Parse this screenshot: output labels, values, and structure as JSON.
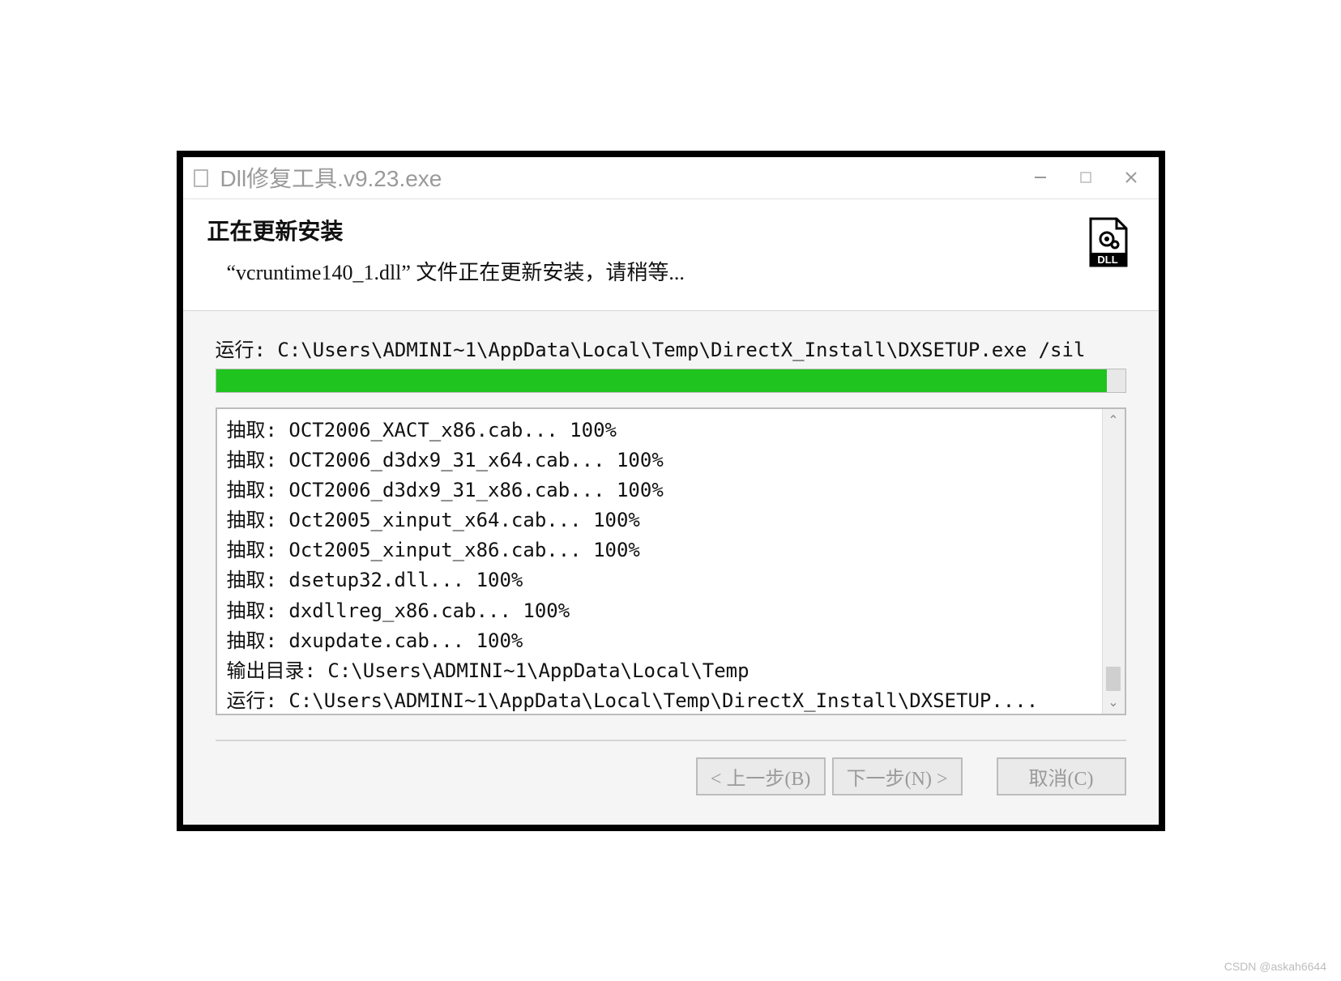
{
  "window": {
    "title": "Dll修复工具.v9.23.exe"
  },
  "header": {
    "title": "正在更新安装",
    "subtitle": "“vcruntime140_1.dll” 文件正在更新安装，请稍等..."
  },
  "progress": {
    "run_label": "运行: C:\\Users\\ADMINI~1\\AppData\\Local\\Temp\\DirectX_Install\\DXSETUP.exe /sil",
    "percent": 98
  },
  "log": {
    "lines": [
      "抽取: OCT2006_XACT_x86.cab... 100%",
      "抽取: OCT2006_d3dx9_31_x64.cab... 100%",
      "抽取: OCT2006_d3dx9_31_x86.cab... 100%",
      "抽取: Oct2005_xinput_x64.cab... 100%",
      "抽取: Oct2005_xinput_x86.cab... 100%",
      "抽取: dsetup32.dll... 100%",
      "抽取: dxdllreg_x86.cab... 100%",
      "抽取: dxupdate.cab... 100%",
      "输出目录: C:\\Users\\ADMINI~1\\AppData\\Local\\Temp",
      "运行: C:\\Users\\ADMINI~1\\AppData\\Local\\Temp\\DirectX_Install\\DXSETUP...."
    ]
  },
  "buttons": {
    "back": "< 上一步(B)",
    "next": "下一步(N) >",
    "cancel": "取消(C)"
  },
  "watermark": "CSDN @askah6644"
}
